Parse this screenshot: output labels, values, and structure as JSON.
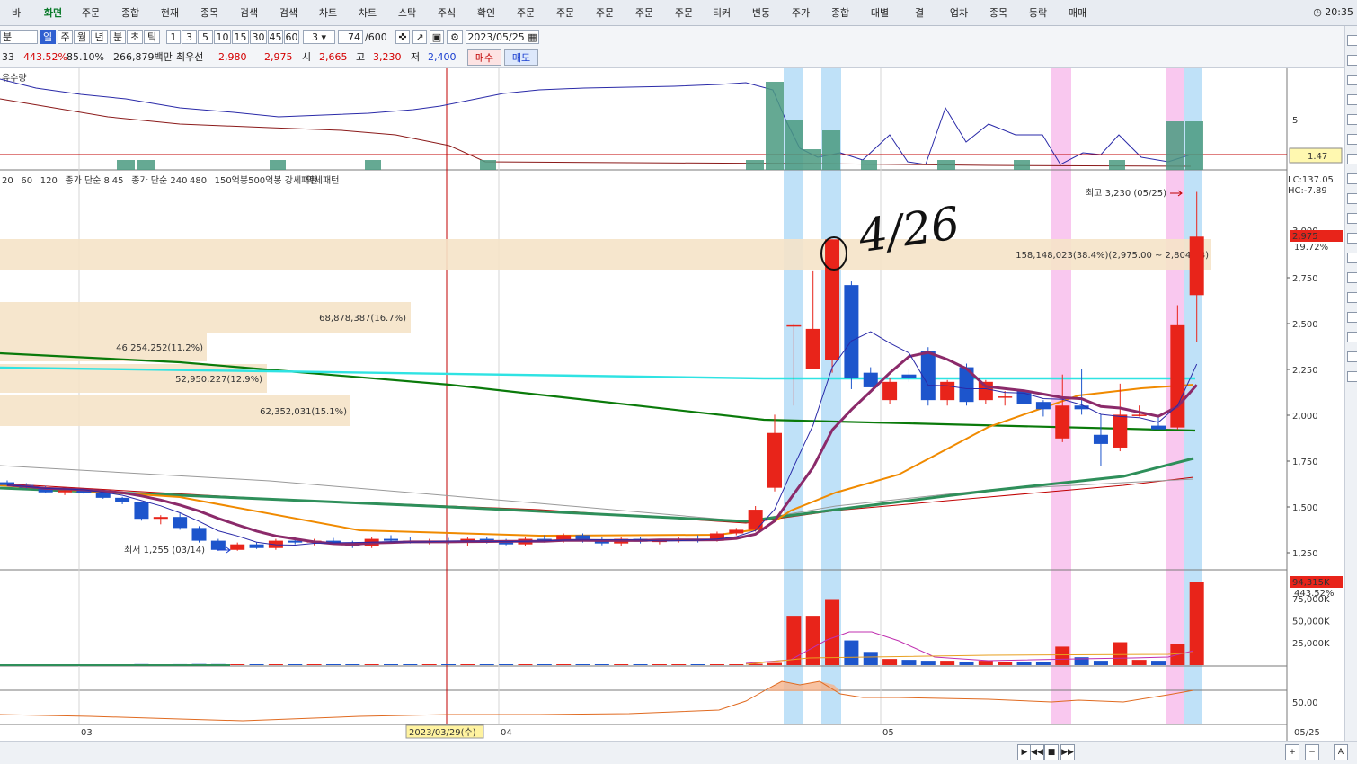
{
  "toolbar": {
    "items": [
      {
        "label": "바"
      },
      {
        "label": "화면"
      },
      {
        "label": "주문"
      },
      {
        "label": "종합"
      },
      {
        "label": "현재"
      },
      {
        "label": "종목"
      },
      {
        "label": "검색"
      },
      {
        "label": "검색"
      },
      {
        "label": "차트"
      },
      {
        "label": "차트"
      },
      {
        "label": "스탁"
      },
      {
        "label": "주식"
      },
      {
        "label": "확인"
      },
      {
        "label": "주문"
      },
      {
        "label": "주문"
      },
      {
        "label": "주문"
      },
      {
        "label": "주문"
      },
      {
        "label": "주문"
      },
      {
        "label": "티커"
      },
      {
        "label": "변동"
      },
      {
        "label": "주가"
      },
      {
        "label": "종합"
      },
      {
        "label": "대별"
      },
      {
        "label": "결"
      },
      {
        "label": "업차"
      },
      {
        "label": "종목"
      },
      {
        "label": "등락"
      },
      {
        "label": "매매"
      }
    ],
    "clock": "20:35"
  },
  "period_bar": {
    "period_label": "분",
    "buttons": [
      {
        "label": "일"
      },
      {
        "label": "주"
      },
      {
        "label": "월"
      },
      {
        "label": "년"
      },
      {
        "label": "분"
      },
      {
        "label": "초"
      },
      {
        "label": "틱"
      },
      {
        "label": "1"
      },
      {
        "label": "3"
      },
      {
        "label": "5"
      },
      {
        "label": "10"
      },
      {
        "label": "15"
      },
      {
        "label": "30"
      },
      {
        "label": "45"
      },
      {
        "label": "60"
      }
    ],
    "minute_select": "3",
    "count": "74",
    "count_total": "/600",
    "date": "2023/05/25"
  },
  "quote_bar": {
    "prefix": "33",
    "change_pct": "443.52%",
    "ratio": "85.10%",
    "amount": "266,879백만",
    "best_label": "최우선",
    "best_ask": "2,980",
    "best_bid": "2,975",
    "open_label": "시",
    "open": "2,665",
    "high_label": "고",
    "high": "3,230",
    "low_label": "저",
    "low": "2,400",
    "buy_label": "매수",
    "sell_label": "매도"
  },
  "upper_panel": {
    "title": "유수량",
    "value_box": "1.47",
    "scale_label": "5"
  },
  "legend": {
    "items": [
      {
        "text": "20",
        "color": "#e08020"
      },
      {
        "text": "60",
        "color": "#c00000"
      },
      {
        "text": "120",
        "color": "#888888"
      },
      {
        "text": "종가 단순 8",
        "color": "#8b1a5a"
      },
      {
        "text": "45",
        "color": "#2a8f2a"
      },
      {
        "text": "종가 단순 240",
        "color": "#0a7a0a"
      },
      {
        "text": "480",
        "color": "#00b0b0"
      },
      {
        "text": "150억봉500억봉 강세패턴",
        "color": "#222222"
      },
      {
        "text": "약세패턴",
        "color": "#222222"
      }
    ]
  },
  "annotations": {
    "handwriting": "4/26",
    "high_marker": "최고 3,230 (05/25)",
    "low_marker": "최저 1,255 (03/14)",
    "volume_profile": [
      {
        "text": "158,148,023(38.4%)(2,975.00 ~ 2,804.38)"
      },
      {
        "text": "68,878,387(16.7%)"
      },
      {
        "text": "46,254,252(11.2%)"
      },
      {
        "text": "52,950,227(12.9%)"
      },
      {
        "text": "62,352,031(15.1%)"
      }
    ],
    "lc": "LC:137.05",
    "hc": "HC:-7.89",
    "price_tag": "2,975",
    "price_pct": "19.72%",
    "volume_tag": "94,315K",
    "volume_pct": "443.52%",
    "crosshair_date": "2023/03/29(수)"
  },
  "chart_data": {
    "type": "candlestick",
    "price_axis": {
      "ticks": [
        "2,750",
        "2,500",
        "2,250",
        "2,000",
        "1,750",
        "1,500",
        "1,250"
      ],
      "top_partial": "3,000"
    },
    "volume_axis": {
      "ticks": [
        "75,000K",
        "50,000K",
        "25,000K"
      ]
    },
    "lower_axis": {
      "ticks": [
        "50.00"
      ]
    },
    "x_labels": [
      {
        "text": "03"
      },
      {
        "text": "04"
      },
      {
        "text": "05"
      },
      {
        "text": "05/25"
      }
    ],
    "candles": [
      [
        1630,
        1640,
        1610,
        1615
      ],
      [
        1615,
        1625,
        1595,
        1600
      ],
      [
        1600,
        1610,
        1570,
        1575
      ],
      [
        1575,
        1590,
        1560,
        1585
      ],
      [
        1585,
        1600,
        1565,
        1570
      ],
      [
        1570,
        1580,
        1540,
        1545
      ],
      [
        1545,
        1550,
        1510,
        1520
      ],
      [
        1520,
        1525,
        1420,
        1430
      ],
      [
        1430,
        1450,
        1400,
        1440
      ],
      [
        1440,
        1460,
        1370,
        1380
      ],
      [
        1380,
        1390,
        1300,
        1310
      ],
      [
        1310,
        1320,
        1255,
        1260
      ],
      [
        1260,
        1300,
        1255,
        1290
      ],
      [
        1290,
        1300,
        1265,
        1270
      ],
      [
        1270,
        1320,
        1260,
        1310
      ],
      [
        1310,
        1330,
        1290,
        1300
      ],
      [
        1300,
        1320,
        1285,
        1310
      ],
      [
        1310,
        1325,
        1295,
        1300
      ],
      [
        1300,
        1310,
        1270,
        1280
      ],
      [
        1280,
        1330,
        1270,
        1320
      ],
      [
        1320,
        1340,
        1300,
        1310
      ],
      [
        1310,
        1330,
        1295,
        1300
      ],
      [
        1300,
        1320,
        1290,
        1310
      ],
      [
        1310,
        1325,
        1290,
        1300
      ],
      [
        1300,
        1330,
        1280,
        1320
      ],
      [
        1320,
        1330,
        1295,
        1305
      ],
      [
        1305,
        1320,
        1285,
        1290
      ],
      [
        1290,
        1330,
        1280,
        1320
      ],
      [
        1320,
        1340,
        1300,
        1310
      ],
      [
        1310,
        1350,
        1300,
        1340
      ],
      [
        1340,
        1350,
        1300,
        1310
      ],
      [
        1310,
        1330,
        1285,
        1295
      ],
      [
        1295,
        1330,
        1280,
        1320
      ],
      [
        1320,
        1330,
        1295,
        1305
      ],
      [
        1305,
        1320,
        1290,
        1310
      ],
      [
        1310,
        1330,
        1300,
        1320
      ],
      [
        1320,
        1340,
        1300,
        1310
      ],
      [
        1310,
        1360,
        1305,
        1350
      ],
      [
        1350,
        1380,
        1340,
        1370
      ],
      [
        1370,
        1500,
        1360,
        1480
      ],
      [
        1600,
        2000,
        1580,
        1900
      ],
      [
        2490,
        2500,
        2050,
        2490
      ],
      [
        2250,
        2790,
        2250,
        2470
      ],
      [
        2300,
        2960,
        2230,
        2960
      ],
      [
        2710,
        2730,
        2140,
        2200
      ],
      [
        2230,
        2260,
        2150,
        2150
      ],
      [
        2080,
        2200,
        2060,
        2180
      ],
      [
        2220,
        2250,
        2180,
        2200
      ],
      [
        2350,
        2370,
        2050,
        2080
      ],
      [
        2080,
        2190,
        2050,
        2180
      ],
      [
        2260,
        2280,
        2050,
        2070
      ],
      [
        2080,
        2190,
        2060,
        2180
      ],
      [
        2100,
        2130,
        2050,
        2100
      ],
      [
        2130,
        2140,
        2060,
        2060
      ],
      [
        2070,
        2080,
        1990,
        2030
      ],
      [
        1870,
        2220,
        1850,
        2050
      ],
      [
        2050,
        2250,
        2000,
        2030
      ],
      [
        1890,
        2000,
        1720,
        1840
      ],
      [
        1820,
        2170,
        1800,
        2000
      ],
      [
        2000,
        2050,
        1990,
        2000
      ],
      [
        1940,
        2000,
        1920,
        1920
      ],
      [
        1930,
        2600,
        1920,
        2490
      ],
      [
        2655,
        3220,
        2400,
        2975
      ]
    ],
    "volumes": [
      900,
      800,
      700,
      800,
      600,
      700,
      600,
      1200,
      900,
      1100,
      1300,
      1200,
      800,
      700,
      900,
      600,
      700,
      600,
      800,
      600,
      700,
      600,
      500,
      600,
      700,
      600,
      500,
      600,
      700,
      600,
      500,
      600,
      700,
      600,
      500,
      600,
      700,
      600,
      700,
      1500,
      2500,
      56000,
      56000,
      75000,
      28000,
      15000,
      7000,
      6000,
      5000,
      5000,
      4000,
      5000,
      4000,
      4000,
      4000,
      21000,
      9000,
      5000,
      26000,
      6000,
      5000,
      24000,
      94315
    ]
  }
}
